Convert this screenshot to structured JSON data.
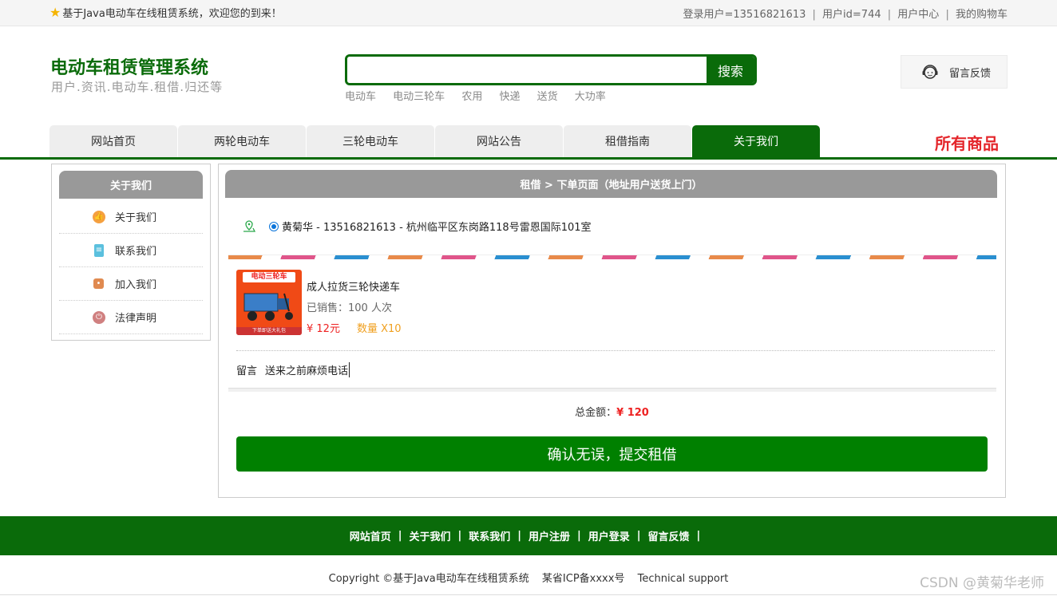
{
  "topbar": {
    "welcome": "基于Java电动车在线租赁系统，欢迎您的到来！",
    "login_user": "登录用户=13516821613",
    "user_id": "用户id=744",
    "user_center": "用户中心",
    "cart": "我的购物车",
    "separator": "|"
  },
  "header": {
    "title": "电动车租赁管理系统",
    "subtitle": "用户.资讯.电动车.租借.归还等",
    "search_placeholder": "",
    "search_button": "搜索",
    "hot_keywords": [
      "电动车",
      "电动三轮车",
      "农用",
      "快递",
      "送货",
      "大功率"
    ],
    "feedback": "留言反馈"
  },
  "nav": {
    "tabs": [
      "网站首页",
      "两轮电动车",
      "三轮电动车",
      "网站公告",
      "租借指南",
      "关于我们"
    ],
    "active_index": 5,
    "all_goods": "所有商品"
  },
  "sidebar": {
    "title": "关于我们",
    "items": [
      {
        "label": "关于我们",
        "icon": "thumb-icon",
        "color": "#f5a040"
      },
      {
        "label": "联系我们",
        "icon": "clipboard-icon",
        "color": "#5bc0de"
      },
      {
        "label": "加入我们",
        "icon": "lock-icon",
        "color": "#e08a50"
      },
      {
        "label": "法律声明",
        "icon": "power-icon",
        "color": "#d08080"
      }
    ]
  },
  "order": {
    "header": "租借 > 下单页面（地址用户送货上门）",
    "address": "黄菊华 - 13516821613 - 杭州临平区东岗路118号雷恩国际101室",
    "product": {
      "thumb_tag": "电动三轮车",
      "thumb_bottom": "下单即送大礼包",
      "name": "成人拉货三轮快递车",
      "sold": "已销售：100 人次",
      "price": "¥ 12元",
      "qty": "数量 X10"
    },
    "note_label": "留言",
    "note_value": "送来之前麻烦电话",
    "total_label": "总金额：",
    "total_value": "¥ 120",
    "submit": "确认无误，提交租借"
  },
  "footer": {
    "links": [
      "网站首页",
      "关于我们",
      "联系我们",
      "用户注册",
      "用户登录",
      "留言反馈"
    ],
    "separator": "|",
    "copyright": "Copyright ©基于Java电动车在线租赁系统",
    "icp": "某省ICP备xxxx号",
    "support": "Technical support",
    "watermark": "CSDN @黄菊华老师"
  },
  "colors": {
    "brand": "#0a6b0a",
    "submit": "#008000",
    "price": "#e22222",
    "qty": "#f0a020",
    "all_goods": "#e4262b"
  }
}
